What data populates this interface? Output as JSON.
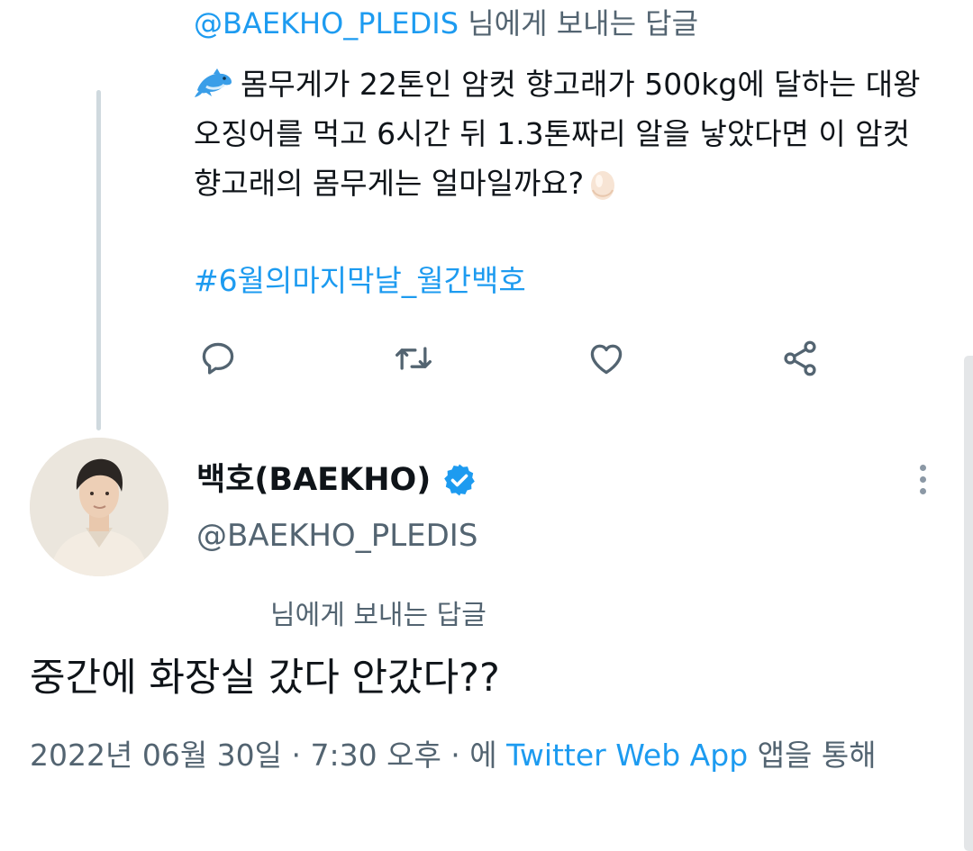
{
  "top_tweet": {
    "reply_handle": "@BAEKHO_PLEDIS",
    "reply_suffix": " 님에게 보내는 답글",
    "text": "몸무게가 22톤인 암컷 향고래가 500kg에 달하는 대왕오징어를 먹고 6시간 뒤 1.3톤짜리 알을 낳았다면 이 암컷 향고래의 몸무게는 얼마일까요?",
    "emoji_start": "dolphin",
    "emoji_end": "egg",
    "hashtag": "#6월의마지막날_월간백호"
  },
  "actions": {
    "icons": [
      "reply-icon",
      "retweet-icon",
      "like-icon",
      "share-icon"
    ],
    "accent": "#536471"
  },
  "main_tweet": {
    "display_name": "백호(BAEKHO)",
    "handle": "@BAEKHO_PLEDIS",
    "verified_color": "#1d9bf0",
    "reply_to_label": "님에게 보내는 답글",
    "text": "중간에 화장실 갔다 안갔다??",
    "date_time": "2022년 06월 30일 · 7:30 오후 · 에 ",
    "client": "Twitter Web App",
    "via_suffix": " 앱을 통해"
  },
  "colors": {
    "link": "#1d9bf0",
    "muted": "#536471",
    "text": "#0f1419"
  }
}
